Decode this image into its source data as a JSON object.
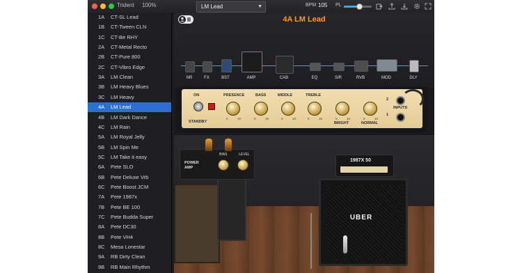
{
  "window": {
    "app_name": "Trident",
    "zoom": "100%",
    "bpm_label": "BPM",
    "bpm_value": "105",
    "pl_label": "PL",
    "pl_level": 0.55
  },
  "preset_dropdown": {
    "value": "LM Lead"
  },
  "presets": [
    {
      "code": "1A",
      "name": "CT-SL Lead"
    },
    {
      "code": "1B",
      "name": "CT-Tween CLN"
    },
    {
      "code": "1C",
      "name": "CT-Be RHY"
    },
    {
      "code": "2A",
      "name": "CT-Metal Recto"
    },
    {
      "code": "2B",
      "name": "CT-Pure 800"
    },
    {
      "code": "2C",
      "name": "CT-Vibro Edge"
    },
    {
      "code": "3A",
      "name": "LM Clean"
    },
    {
      "code": "3B",
      "name": "LM Heavy Blues"
    },
    {
      "code": "3C",
      "name": "LM Heavy"
    },
    {
      "code": "4A",
      "name": "LM Lead"
    },
    {
      "code": "4B",
      "name": "LM Dark Dance"
    },
    {
      "code": "4C",
      "name": "LM Rain"
    },
    {
      "code": "5A",
      "name": "LM Royal Jelly"
    },
    {
      "code": "5B",
      "name": "LM Spin Me"
    },
    {
      "code": "5C",
      "name": "LM Take it easy"
    },
    {
      "code": "6A",
      "name": "Pete SLO"
    },
    {
      "code": "6B",
      "name": "Pete Deluxe Vrb"
    },
    {
      "code": "6C",
      "name": "Pete Boost JCM"
    },
    {
      "code": "7A",
      "name": "Pete 1987x"
    },
    {
      "code": "7B",
      "name": "Pete BE 100"
    },
    {
      "code": "7C",
      "name": "Pete Budda Super"
    },
    {
      "code": "8A",
      "name": "Pete DC30"
    },
    {
      "code": "8B",
      "name": "Pete VH4"
    },
    {
      "code": "8C",
      "name": "Mesa Lonestar"
    },
    {
      "code": "9A",
      "name": "RB Dirty Clean"
    },
    {
      "code": "9B",
      "name": "RB Main Rhythm"
    }
  ],
  "selected_preset": "4A",
  "stage": {
    "title": "4A LM Lead",
    "chain": [
      "NR",
      "FX",
      "BST",
      "AMP",
      "CAB",
      "EQ",
      "S/R",
      "RVB",
      "MOD",
      "DLY"
    ]
  },
  "amp": {
    "on_label": "ON",
    "standby_label": "STANDBY",
    "controls": [
      "PRESENCE",
      "BASS",
      "MIDDLE",
      "TREBLE"
    ],
    "bright_label": "BRIGHT",
    "normal_label": "NORMAL",
    "inputs_label": "INPUTS",
    "input_1": "1",
    "input_2": "2",
    "scale_min": "0",
    "scale_max": "10"
  },
  "power_amp": {
    "label": "POWER AMP",
    "bias_label": "BIAS",
    "level_label": "LEVEL"
  },
  "cab": {
    "brand": "UBER",
    "head_label": "1987X 50"
  },
  "colors": {
    "accent": "#ff9a1f",
    "selection": "#2a6fd1",
    "chain_line": "#4aa7c9"
  }
}
